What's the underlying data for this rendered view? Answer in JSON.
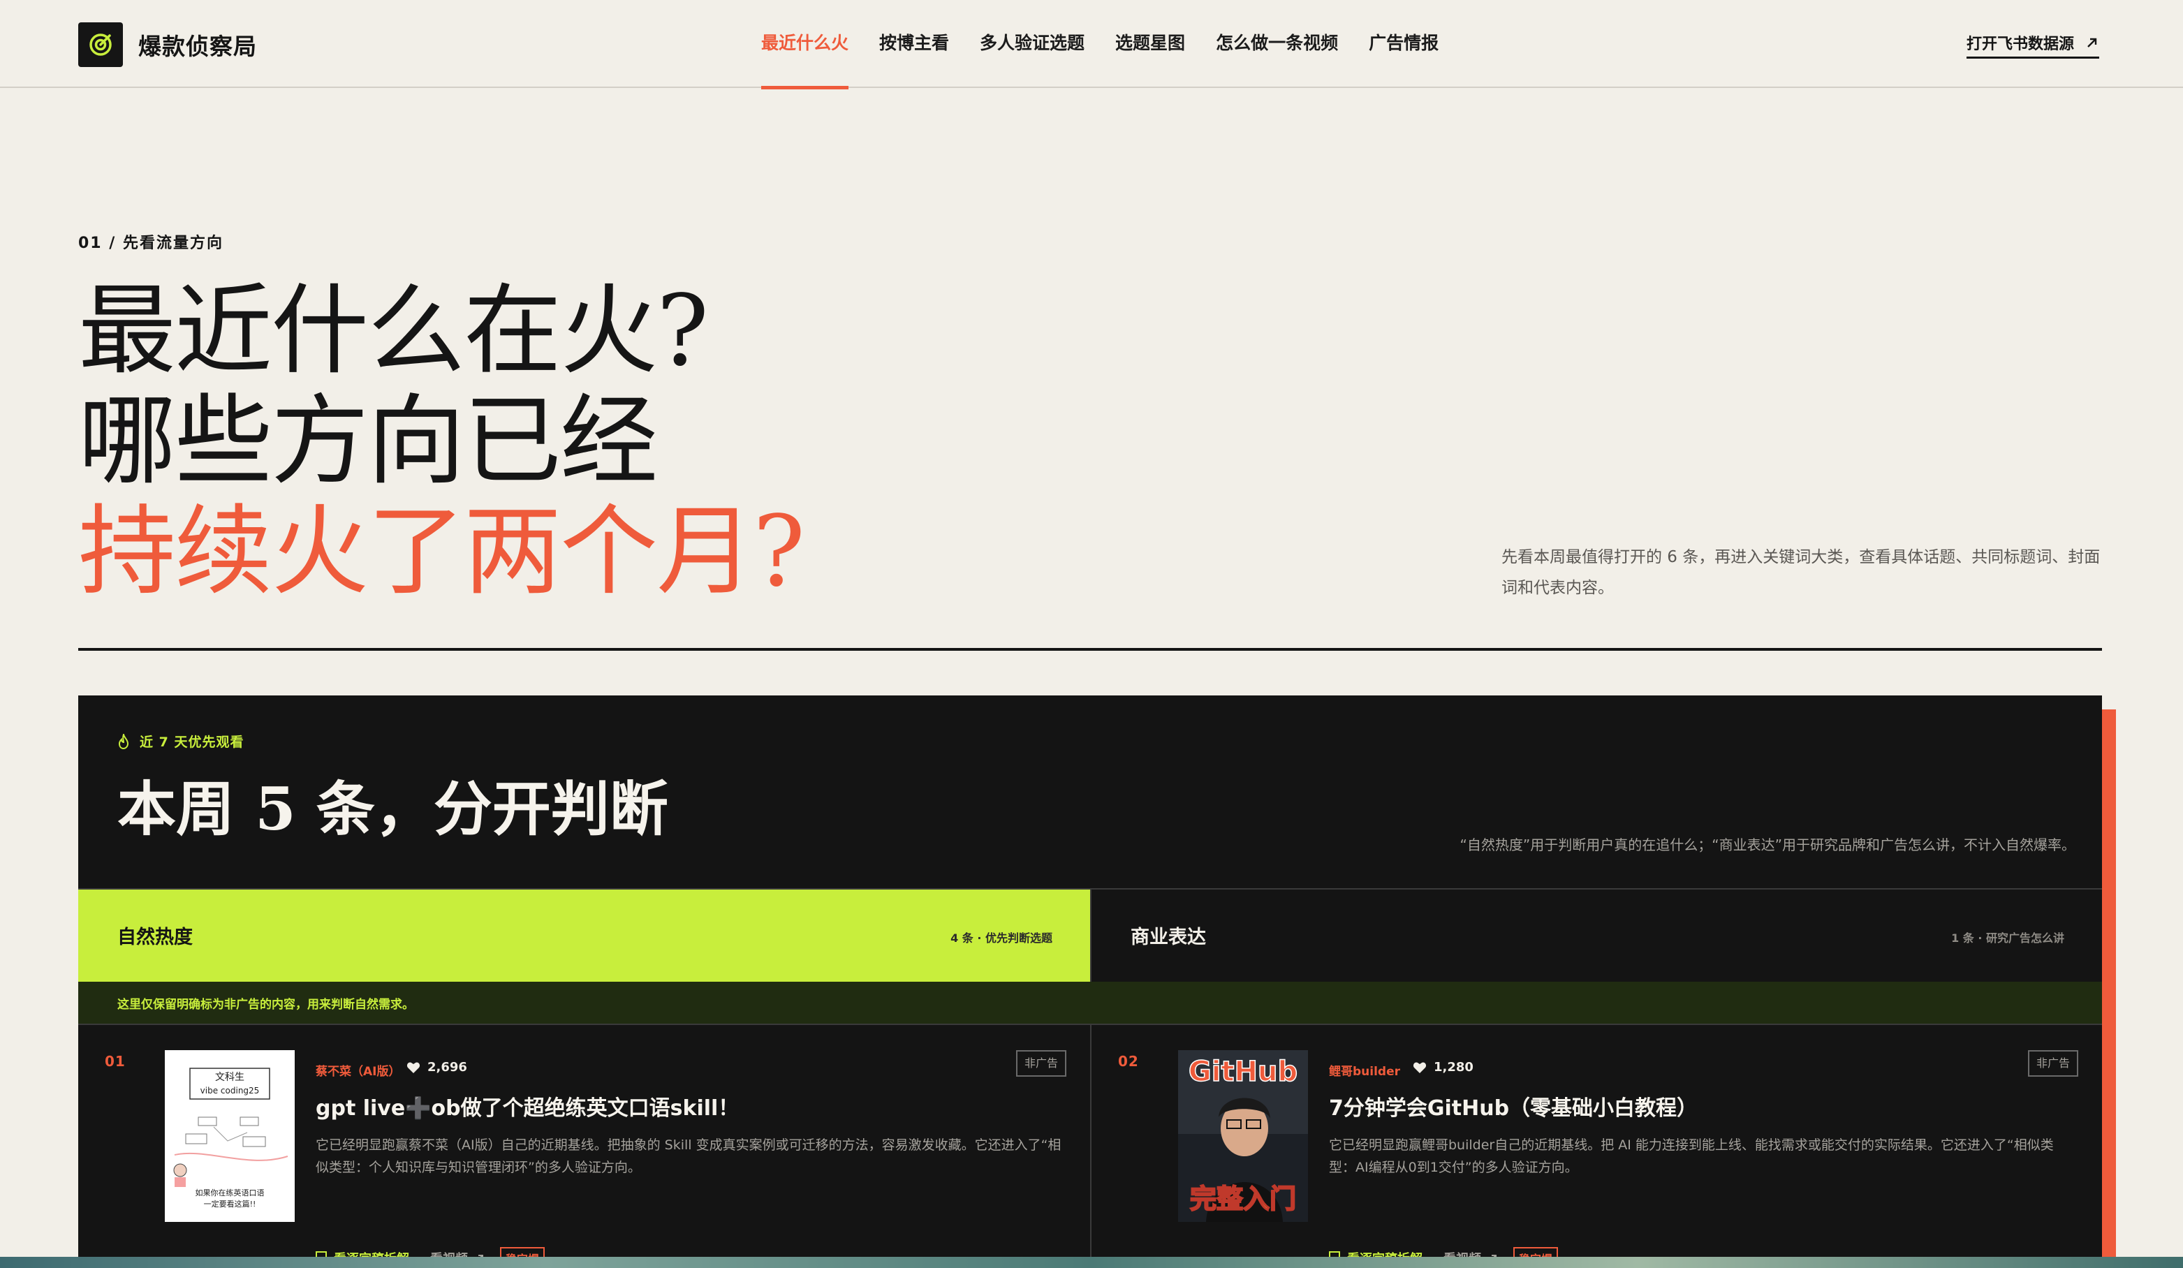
{
  "header": {
    "brand_name": "爆款侦察局",
    "nav": [
      {
        "label": "最近什么火",
        "active": true
      },
      {
        "label": "按博主看",
        "active": false
      },
      {
        "label": "多人验证选题",
        "active": false
      },
      {
        "label": "选题星图",
        "active": false
      },
      {
        "label": "怎么做一条视频",
        "active": false
      },
      {
        "label": "广告情报",
        "active": false
      }
    ],
    "feishu_label": "打开飞书数据源",
    "feishu_icon": "arrow-up-right-icon"
  },
  "hero": {
    "section_label": "01 / 先看流量方向",
    "title_line1": "最近什么在火?",
    "title_line2": "哪些方向已经",
    "title_line3": "持续火了两个月?",
    "description": "先看本周最值得打开的 6 条，再进入关键词大类，查看具体话题、共同标题词、封面词和代表内容。"
  },
  "panel": {
    "tag": "近 7 天优先观看",
    "title": "本周 5 条，分开判断",
    "note": "“自然热度”用于判断用户真的在追什么；“商业表达”用于研究品牌和广告怎么讲，不计入自然爆率。",
    "tabs": {
      "natural": {
        "label": "自然热度",
        "meta": "4 条 · 优先判断选题"
      },
      "commercial": {
        "label": "商业表达",
        "meta": "1 条 · 研究广告怎么讲"
      }
    },
    "filter_text": "这里仅保留明确标为非广告的内容，用来判断自然需求。",
    "cards": [
      {
        "rank": "01",
        "author": "蔡不菜（AI版）",
        "likes": "2,696",
        "badge": "非广告",
        "title": "gpt live➕ob做了个超绝练英文口语skill！",
        "description": "它已经明显跑赢蔡不菜（AI版）自己的近期基线。把抽象的 Skill 变成真实案例或可迁移的方法，容易激发收藏。它还进入了“相似类型：个人知识库与知识管理闭环”的多人验证方向。",
        "thumb": {
          "line1": "文科生",
          "line2": "vibe coding25",
          "caption1": "如果你在练英语口语",
          "caption2": "一定要看这篇!!"
        },
        "actions": {
          "analysis": "看逐字稿拆解",
          "video": "看视频",
          "tag": "稳定爆"
        }
      },
      {
        "rank": "02",
        "author": "鲤哥builder",
        "likes": "1,280",
        "badge": "非广告",
        "title": "7分钟学会GitHub（零基础小白教程）",
        "description": "它已经明显跑赢鲤哥builder自己的近期基线。把 AI 能力连接到能上线、能找需求或能交付的实际结果。它还进入了“相似类型：AI编程从0到1交付”的多人验证方向。",
        "thumb": {
          "top": "GitHub",
          "bottom": "完整入门"
        },
        "actions": {
          "analysis": "看逐字稿拆解",
          "video": "看视频",
          "tag": "稳定爆"
        }
      }
    ]
  },
  "colors": {
    "accent": "#ef5b3b",
    "lime": "#c8ee3c",
    "background": "#f2efe8",
    "panel": "#141414"
  }
}
